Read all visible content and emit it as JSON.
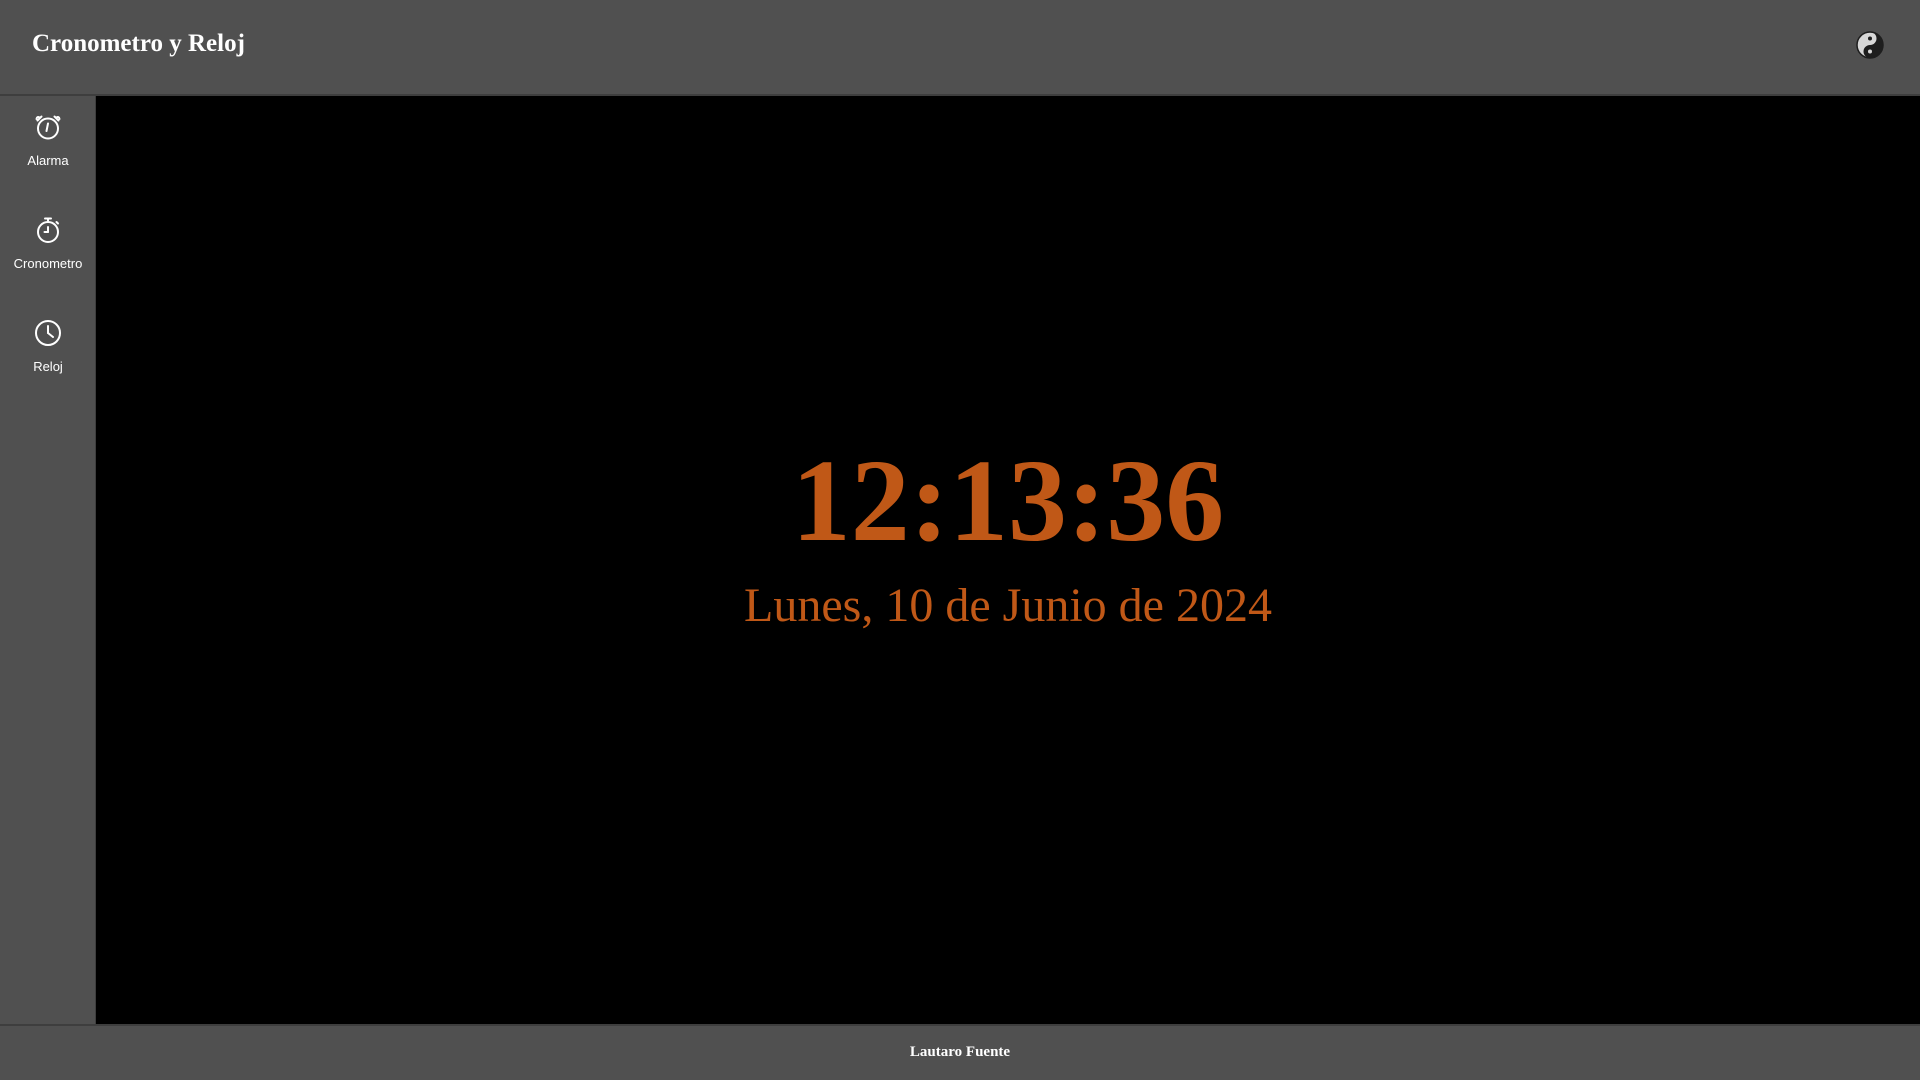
{
  "header": {
    "title": "Cronometro y Reloj",
    "theme_toggle_icon": "yin-yang-icon"
  },
  "sidebar": {
    "items": [
      {
        "label": "Alarma",
        "icon": "alarm-clock-icon"
      },
      {
        "label": "Cronometro",
        "icon": "stopwatch-icon"
      },
      {
        "label": "Reloj",
        "icon": "clock-icon"
      }
    ]
  },
  "clock": {
    "time": "12:13:36",
    "date": "Lunes, 10 de Junio de 2024"
  },
  "footer": {
    "author": "Lautaro Fuente"
  },
  "colors": {
    "chrome_background": "#505050",
    "main_background": "#000000",
    "accent": "#c05817",
    "text": "#ffffff"
  }
}
